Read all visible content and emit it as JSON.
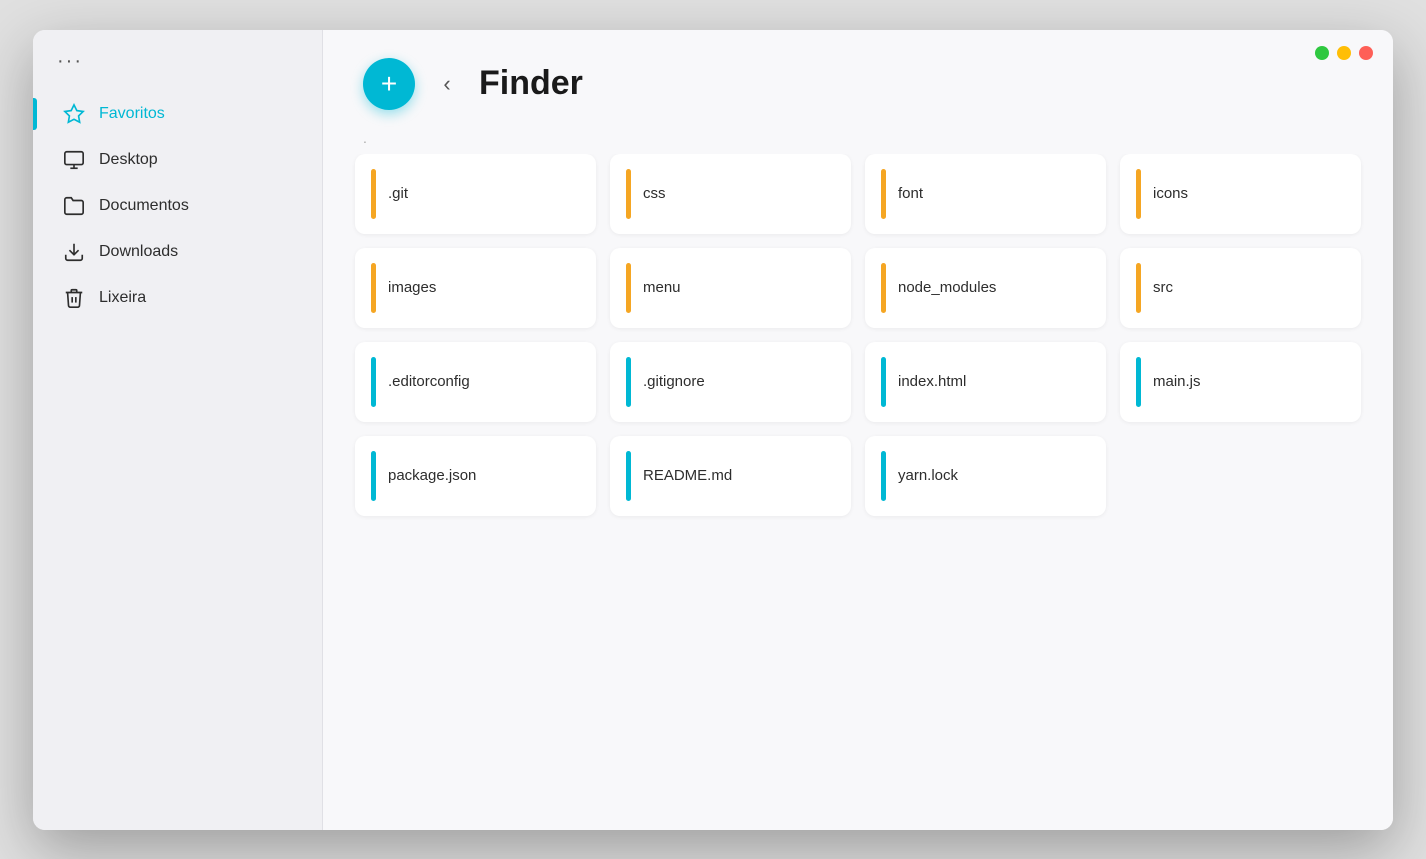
{
  "window": {
    "title": "Finder"
  },
  "titlebar": {
    "dots": [
      {
        "color": "green",
        "class": "dot-green"
      },
      {
        "color": "yellow",
        "class": "dot-yellow"
      },
      {
        "color": "red",
        "class": "dot-red"
      }
    ]
  },
  "sidebar": {
    "more_icon": "···",
    "items": [
      {
        "id": "favoritos",
        "label": "Favoritos",
        "active": true
      },
      {
        "id": "desktop",
        "label": "Desktop",
        "active": false
      },
      {
        "id": "documentos",
        "label": "Documentos",
        "active": false
      },
      {
        "id": "downloads",
        "label": "Downloads",
        "active": false
      },
      {
        "id": "lixeira",
        "label": "Lixeira",
        "active": false
      }
    ]
  },
  "header": {
    "fab_label": "+",
    "back_label": "‹",
    "title": "Finder"
  },
  "breadcrumb": ".",
  "files": [
    {
      "name": ".git",
      "type": "folder",
      "accent": "yellow"
    },
    {
      "name": "css",
      "type": "folder",
      "accent": "yellow"
    },
    {
      "name": "font",
      "type": "folder",
      "accent": "yellow"
    },
    {
      "name": "icons",
      "type": "folder",
      "accent": "yellow"
    },
    {
      "name": "images",
      "type": "folder",
      "accent": "yellow"
    },
    {
      "name": "menu",
      "type": "folder",
      "accent": "yellow"
    },
    {
      "name": "node_modules",
      "type": "folder",
      "accent": "yellow"
    },
    {
      "name": "src",
      "type": "folder",
      "accent": "yellow"
    },
    {
      "name": ".editorconfig",
      "type": "file",
      "accent": "blue"
    },
    {
      "name": ".gitignore",
      "type": "file",
      "accent": "blue"
    },
    {
      "name": "index.html",
      "type": "file",
      "accent": "blue"
    },
    {
      "name": "main.js",
      "type": "file",
      "accent": "blue"
    },
    {
      "name": "package.json",
      "type": "file",
      "accent": "blue"
    },
    {
      "name": "README.md",
      "type": "file",
      "accent": "blue"
    },
    {
      "name": "yarn.lock",
      "type": "file",
      "accent": "blue"
    }
  ]
}
